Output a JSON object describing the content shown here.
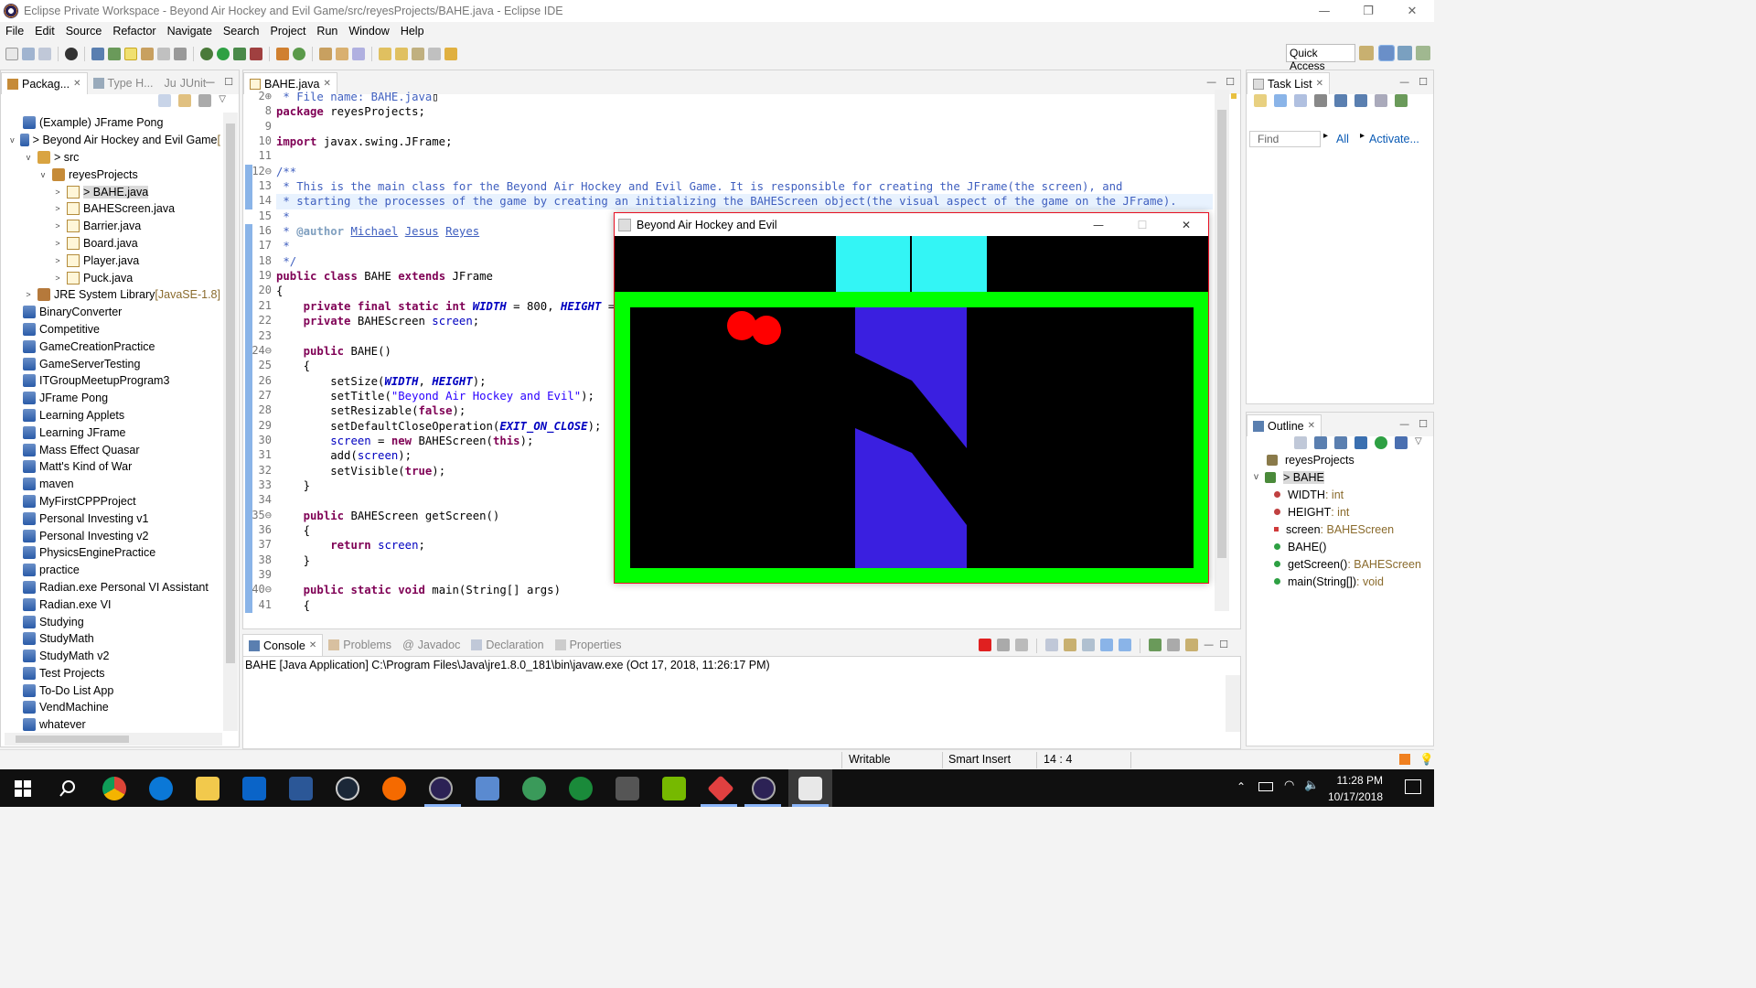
{
  "window": {
    "title": "Eclipse Private Workspace - Beyond Air Hockey and Evil Game/src/reyesProjects/BAHE.java - Eclipse IDE"
  },
  "menu": [
    "File",
    "Edit",
    "Source",
    "Refactor",
    "Navigate",
    "Search",
    "Project",
    "Run",
    "Window",
    "Help"
  ],
  "quick_access": "Quick Access",
  "package_explorer": {
    "tabs": [
      "Packag...",
      "Type H...",
      "JUnit"
    ],
    "junit_prefix": "Ju",
    "tree": [
      {
        "label": "(Example) JFrame Pong",
        "depth": 0,
        "twisty": "",
        "icon": "project"
      },
      {
        "label": "> Beyond Air Hockey and Evil Game",
        "suffix": " [",
        "depth": 0,
        "twisty": "v",
        "icon": "project"
      },
      {
        "label": "> src",
        "depth": 1,
        "twisty": "v",
        "icon": "src"
      },
      {
        "label": "reyesProjects",
        "depth": 2,
        "twisty": "v",
        "icon": "pkg"
      },
      {
        "label": "> BAHE.java",
        "depth": 3,
        "twisty": ">",
        "icon": "java",
        "selected": true
      },
      {
        "label": "BAHEScreen.java",
        "depth": 3,
        "twisty": ">",
        "icon": "java"
      },
      {
        "label": "Barrier.java",
        "depth": 3,
        "twisty": ">",
        "icon": "java"
      },
      {
        "label": "Board.java",
        "depth": 3,
        "twisty": ">",
        "icon": "java"
      },
      {
        "label": "Player.java",
        "depth": 3,
        "twisty": ">",
        "icon": "java"
      },
      {
        "label": "Puck.java",
        "depth": 3,
        "twisty": ">",
        "icon": "java"
      },
      {
        "label": "JRE System Library",
        "suffix": " [JavaSE-1.8]",
        "depth": 1,
        "twisty": ">",
        "icon": "lib"
      },
      {
        "label": "BinaryConverter",
        "depth": 0,
        "twisty": "",
        "icon": "project"
      },
      {
        "label": "Competitive",
        "depth": 0,
        "twisty": "",
        "icon": "project"
      },
      {
        "label": "GameCreationPractice",
        "depth": 0,
        "twisty": "",
        "icon": "project"
      },
      {
        "label": "GameServerTesting",
        "depth": 0,
        "twisty": "",
        "icon": "project"
      },
      {
        "label": "ITGroupMeetupProgram3",
        "depth": 0,
        "twisty": "",
        "icon": "project"
      },
      {
        "label": "JFrame Pong",
        "depth": 0,
        "twisty": "",
        "icon": "project"
      },
      {
        "label": "Learning Applets",
        "depth": 0,
        "twisty": "",
        "icon": "project"
      },
      {
        "label": "Learning JFrame",
        "depth": 0,
        "twisty": "",
        "icon": "project"
      },
      {
        "label": "Mass Effect Quasar",
        "depth": 0,
        "twisty": "",
        "icon": "project"
      },
      {
        "label": "Matt's Kind of War",
        "depth": 0,
        "twisty": "",
        "icon": "project"
      },
      {
        "label": "maven",
        "depth": 0,
        "twisty": "",
        "icon": "project"
      },
      {
        "label": "MyFirstCPPProject",
        "depth": 0,
        "twisty": "",
        "icon": "project"
      },
      {
        "label": "Personal Investing v1",
        "depth": 0,
        "twisty": "",
        "icon": "project"
      },
      {
        "label": "Personal Investing v2",
        "depth": 0,
        "twisty": "",
        "icon": "project"
      },
      {
        "label": "PhysicsEnginePractice",
        "depth": 0,
        "twisty": "",
        "icon": "project"
      },
      {
        "label": "practice",
        "depth": 0,
        "twisty": "",
        "icon": "project"
      },
      {
        "label": "Radian.exe Personal VI Assistant",
        "depth": 0,
        "twisty": "",
        "icon": "project"
      },
      {
        "label": "Radian.exe VI",
        "depth": 0,
        "twisty": "",
        "icon": "project"
      },
      {
        "label": "Studying",
        "depth": 0,
        "twisty": "",
        "icon": "project"
      },
      {
        "label": "StudyMath",
        "depth": 0,
        "twisty": "",
        "icon": "project"
      },
      {
        "label": "StudyMath v2",
        "depth": 0,
        "twisty": "",
        "icon": "project"
      },
      {
        "label": "Test Projects",
        "depth": 0,
        "twisty": "",
        "icon": "project"
      },
      {
        "label": "To-Do List App",
        "depth": 0,
        "twisty": "",
        "icon": "project"
      },
      {
        "label": "VendMachine",
        "depth": 0,
        "twisty": "",
        "icon": "project"
      },
      {
        "label": "whatever",
        "depth": 0,
        "twisty": "",
        "icon": "project"
      }
    ]
  },
  "editor": {
    "tab": "BAHE.java",
    "line_numbers": [
      "2⊕",
      "8",
      "9",
      "10",
      "11",
      "12⊖",
      "13",
      "14",
      "15",
      "16",
      "17",
      "18",
      "19",
      "20",
      "21",
      "22",
      "23",
      "24⊖",
      "25",
      "26",
      "27",
      "28",
      "29",
      "30",
      "31",
      "32",
      "33",
      "34",
      "35⊖",
      "36",
      "37",
      "38",
      "39",
      "40⊖",
      "41"
    ],
    "lines": [
      [
        {
          "t": " * File name: BAHE.java",
          "c": "cm"
        },
        {
          "t": "▯",
          "c": ""
        }
      ],
      [
        {
          "t": "package",
          "c": "kw"
        },
        {
          "t": " reyesProjects;",
          "c": ""
        }
      ],
      [],
      [
        {
          "t": "import",
          "c": "kw"
        },
        {
          "t": " javax.swing.JFrame;",
          "c": ""
        }
      ],
      [],
      [
        {
          "t": "/**",
          "c": "cm"
        }
      ],
      [
        {
          "t": " * This is the main class for the Beyond Air Hockey and Evil Game. It is responsible for creating the JFrame(the screen), and",
          "c": "cm"
        }
      ],
      [
        {
          "t": " * starting the processes of the game by creating an initializing the BAHEScreen object(the visual aspect of the game on the JFrame).",
          "c": "cm"
        }
      ],
      [
        {
          "t": " *",
          "c": "cm"
        }
      ],
      [
        {
          "t": " * ",
          "c": "cm"
        },
        {
          "t": "@author",
          "c": "tag"
        },
        {
          "t": " ",
          "c": "cm"
        },
        {
          "t": "Michael",
          "c": "lnk"
        },
        {
          "t": " ",
          "c": "cm"
        },
        {
          "t": "Jesus",
          "c": "lnk"
        },
        {
          "t": " ",
          "c": "cm"
        },
        {
          "t": "Reyes",
          "c": "lnk"
        }
      ],
      [
        {
          "t": " *",
          "c": "cm"
        }
      ],
      [
        {
          "t": " */",
          "c": "cm"
        }
      ],
      [
        {
          "t": "public",
          "c": "kw"
        },
        {
          "t": " ",
          "c": ""
        },
        {
          "t": "class",
          "c": "kw"
        },
        {
          "t": " BAHE ",
          "c": ""
        },
        {
          "t": "extends",
          "c": "kw"
        },
        {
          "t": " JFrame",
          "c": ""
        }
      ],
      [
        {
          "t": "{",
          "c": ""
        }
      ],
      [
        {
          "t": "    ",
          "c": ""
        },
        {
          "t": "private",
          "c": "kw"
        },
        {
          "t": " ",
          "c": ""
        },
        {
          "t": "final",
          "c": "kw"
        },
        {
          "t": " ",
          "c": ""
        },
        {
          "t": "static",
          "c": "kw"
        },
        {
          "t": " ",
          "c": ""
        },
        {
          "t": "int",
          "c": "kw"
        },
        {
          "t": " ",
          "c": ""
        },
        {
          "t": "WIDTH",
          "c": "sfld"
        },
        {
          "t": " = 800, ",
          "c": ""
        },
        {
          "t": "HEIGHT",
          "c": "sfld"
        },
        {
          "t": " =",
          "c": ""
        }
      ],
      [
        {
          "t": "    ",
          "c": ""
        },
        {
          "t": "private",
          "c": "kw"
        },
        {
          "t": " BAHEScreen ",
          "c": ""
        },
        {
          "t": "screen",
          "c": "fld"
        },
        {
          "t": ";",
          "c": ""
        }
      ],
      [],
      [
        {
          "t": "    ",
          "c": ""
        },
        {
          "t": "public",
          "c": "kw"
        },
        {
          "t": " BAHE()",
          "c": ""
        }
      ],
      [
        {
          "t": "    {",
          "c": ""
        }
      ],
      [
        {
          "t": "        setSize(",
          "c": ""
        },
        {
          "t": "WIDTH",
          "c": "sfld"
        },
        {
          "t": ", ",
          "c": ""
        },
        {
          "t": "HEIGHT",
          "c": "sfld"
        },
        {
          "t": ");",
          "c": ""
        }
      ],
      [
        {
          "t": "        setTitle(",
          "c": ""
        },
        {
          "t": "\"Beyond Air Hockey and Evil\"",
          "c": "str"
        },
        {
          "t": ");",
          "c": ""
        }
      ],
      [
        {
          "t": "        setResizable(",
          "c": ""
        },
        {
          "t": "false",
          "c": "kw"
        },
        {
          "t": ");",
          "c": ""
        }
      ],
      [
        {
          "t": "        setDefaultCloseOperation(",
          "c": ""
        },
        {
          "t": "EXIT_ON_CLOSE",
          "c": "sfld"
        },
        {
          "t": ");",
          "c": ""
        }
      ],
      [
        {
          "t": "        ",
          "c": ""
        },
        {
          "t": "screen",
          "c": "fld"
        },
        {
          "t": " = ",
          "c": ""
        },
        {
          "t": "new",
          "c": "kw"
        },
        {
          "t": " BAHEScreen(",
          "c": ""
        },
        {
          "t": "this",
          "c": "kw"
        },
        {
          "t": ");",
          "c": ""
        }
      ],
      [
        {
          "t": "        add(",
          "c": ""
        },
        {
          "t": "screen",
          "c": "fld"
        },
        {
          "t": ");",
          "c": ""
        }
      ],
      [
        {
          "t": "        setVisible(",
          "c": ""
        },
        {
          "t": "true",
          "c": "kw"
        },
        {
          "t": ");",
          "c": ""
        }
      ],
      [
        {
          "t": "    }",
          "c": ""
        }
      ],
      [],
      [
        {
          "t": "    ",
          "c": ""
        },
        {
          "t": "public",
          "c": "kw"
        },
        {
          "t": " BAHEScreen getScreen()",
          "c": ""
        }
      ],
      [
        {
          "t": "    {",
          "c": ""
        }
      ],
      [
        {
          "t": "        ",
          "c": ""
        },
        {
          "t": "return",
          "c": "kw"
        },
        {
          "t": " ",
          "c": ""
        },
        {
          "t": "screen",
          "c": "fld"
        },
        {
          "t": ";",
          "c": ""
        }
      ],
      [
        {
          "t": "    }",
          "c": ""
        }
      ],
      [],
      [
        {
          "t": "    ",
          "c": ""
        },
        {
          "t": "public",
          "c": "kw"
        },
        {
          "t": " ",
          "c": ""
        },
        {
          "t": "static",
          "c": "kw"
        },
        {
          "t": " ",
          "c": ""
        },
        {
          "t": "void",
          "c": "kw"
        },
        {
          "t": " main(String[] args)",
          "c": ""
        }
      ],
      [
        {
          "t": "    {",
          "c": ""
        }
      ]
    ]
  },
  "game_window": {
    "title": "Beyond Air Hockey and Evil",
    "colors": {
      "frame": "#00ff00",
      "goal": "#33f5f5",
      "barrier": "#3a1fe0",
      "puck": "#ff0000",
      "bg": "#000000"
    }
  },
  "console": {
    "tabs": [
      "Console",
      "Problems",
      "Javadoc",
      "Declaration",
      "Properties"
    ],
    "description": "BAHE [Java Application] C:\\Program Files\\Java\\jre1.8.0_181\\bin\\javaw.exe (Oct 17, 2018, 11:26:17 PM)"
  },
  "task_list": {
    "tab": "Task List",
    "find_placeholder": "Find",
    "all_link": "All",
    "activate_link": "Activate..."
  },
  "outline": {
    "tab": "Outline",
    "items": [
      {
        "label": "reyesProjects",
        "type": "",
        "depth": 0,
        "kind": "package"
      },
      {
        "label": "> BAHE",
        "type": "",
        "depth": 0,
        "kind": "class"
      },
      {
        "label": "WIDTH",
        "type": " : int",
        "depth": 1,
        "kind": "static-final-field"
      },
      {
        "label": "HEIGHT",
        "type": " : int",
        "depth": 1,
        "kind": "static-final-field"
      },
      {
        "label": "screen",
        "type": " : BAHEScreen",
        "depth": 1,
        "kind": "private-field"
      },
      {
        "label": "BAHE()",
        "type": "",
        "depth": 1,
        "kind": "constructor"
      },
      {
        "label": "getScreen()",
        "type": " : BAHEScreen",
        "depth": 1,
        "kind": "method"
      },
      {
        "label": "main(String[])",
        "type": " : void",
        "depth": 1,
        "kind": "static-method"
      }
    ]
  },
  "status": {
    "writable": "Writable",
    "insert_mode": "Smart Insert",
    "position": "14 : 4"
  },
  "taskbar": {
    "time": "11:28 PM",
    "date": "10/17/2018"
  }
}
